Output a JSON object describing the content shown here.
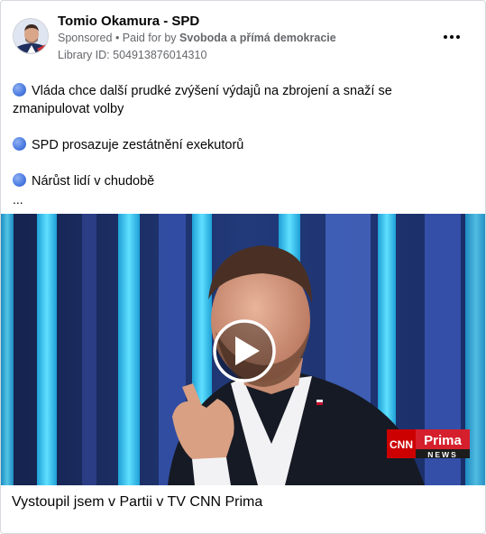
{
  "post": {
    "page_name": "Tomio Okamura - SPD",
    "sponsored": "Sponsored",
    "separator": " • ",
    "paid_for_prefix": "Paid for by ",
    "paid_for_name": "Svoboda a přímá demokracie",
    "library_id": "Library ID: 504913876014310",
    "more_icon": "more-horizontal-icon",
    "paragraphs": [
      "Vláda chce další prudké zvýšení výdajů na zbrojení a snaží se zmanipulovat volby",
      "SPD prosazuje zestátnění exekutorů",
      "Nárůst lidí v chudobě"
    ],
    "bullet_icon": "blue-circle-icon",
    "truncation": "...",
    "video": {
      "play_icon": "play-icon",
      "logo_cnn": "CNN",
      "logo_prima": "Prima",
      "logo_news": "NEWS"
    },
    "caption": "Vystoupil jsem v Partii v TV CNN Prima"
  },
  "colors": {
    "text_primary": "#050505",
    "text_secondary": "#65676b",
    "bullet_blue": "#4a7ae0",
    "cnn_red": "#cc0000",
    "studio_cyan": "#35c6e8"
  }
}
